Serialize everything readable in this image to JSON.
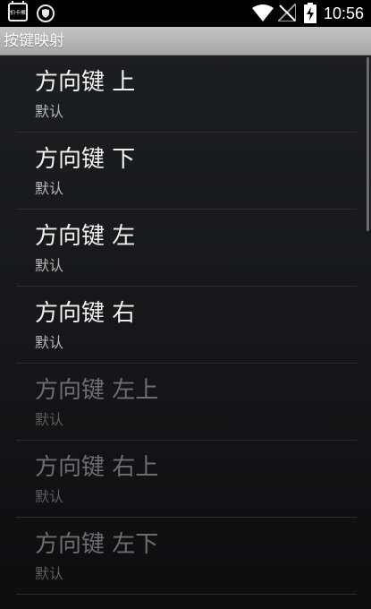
{
  "status_bar": {
    "app_icon_text": "拍卡聚",
    "time": "10:56",
    "icons": [
      "app-notification-icon",
      "shield-icon",
      "wifi-icon",
      "no-signal-icon",
      "battery-charging-icon"
    ]
  },
  "title_bar": {
    "title": "按键映射"
  },
  "items": [
    {
      "title": "方向键 上",
      "summary": "默认",
      "enabled": true
    },
    {
      "title": "方向键 下",
      "summary": "默认",
      "enabled": true
    },
    {
      "title": "方向键 左",
      "summary": "默认",
      "enabled": true
    },
    {
      "title": "方向键 右",
      "summary": "默认",
      "enabled": true
    },
    {
      "title": "方向键 左上",
      "summary": "默认",
      "enabled": false
    },
    {
      "title": "方向键 右上",
      "summary": "默认",
      "enabled": false
    },
    {
      "title": "方向键 左下",
      "summary": "默认",
      "enabled": false
    }
  ],
  "colors": {
    "status_bar_bg": "#000000",
    "title_bar_bg": "#b5b5b5",
    "list_bg": "#17191c",
    "enabled_text": "#f2f2f2",
    "disabled_text": "#6c6f72"
  }
}
